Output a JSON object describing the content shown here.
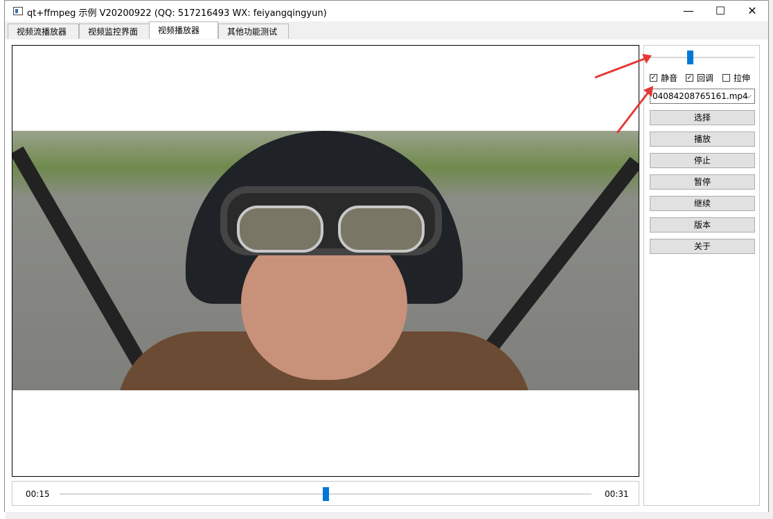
{
  "window": {
    "title": "qt+ffmpeg 示例 V20200922 (QQ: 517216493 WX: feiyangqingyun)",
    "controls": {
      "minimize": "—",
      "maximize": "☐",
      "close": "✕"
    }
  },
  "tabs": [
    {
      "label": "视频流播放器"
    },
    {
      "label": "视频监控界面"
    },
    {
      "label": "视频播放器",
      "active": true
    },
    {
      "label": "其他功能测试"
    }
  ],
  "player": {
    "current_time": "00:15",
    "total_time": "00:31",
    "progress_fraction": 0.5
  },
  "side": {
    "volume_fraction": 0.38,
    "checkboxes": [
      {
        "label": "静音",
        "checked": true
      },
      {
        "label": "回调",
        "checked": true
      },
      {
        "label": "拉伸",
        "checked": false
      }
    ],
    "file_combo": {
      "value": "04084208765161.mp4"
    },
    "buttons": [
      {
        "label": "选择"
      },
      {
        "label": "播放"
      },
      {
        "label": "停止"
      },
      {
        "label": "暂停"
      },
      {
        "label": "继续"
      },
      {
        "label": "版本"
      },
      {
        "label": "关于"
      }
    ]
  },
  "colors": {
    "accent": "#0078d7",
    "annotation_arrow": "#e53935"
  },
  "icons": {
    "check": "☑",
    "dropdown": "chevron-down-icon"
  }
}
